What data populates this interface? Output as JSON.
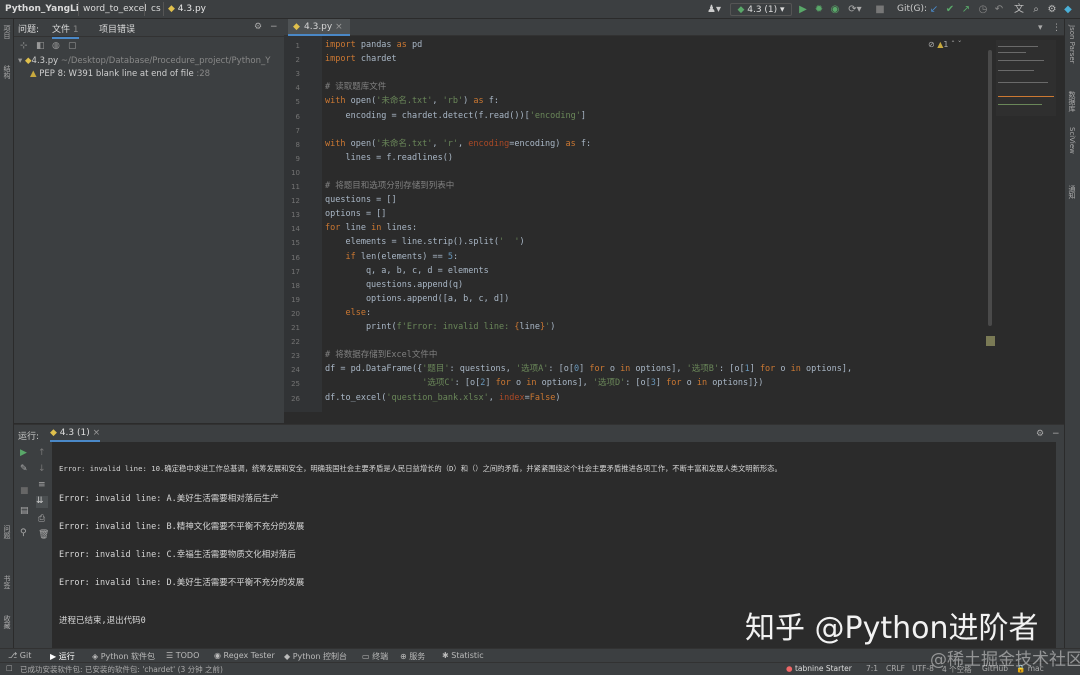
{
  "breadcrumbs": {
    "project": "Python_YangLi",
    "file1": "word_to_excel",
    "file2": "cs",
    "file3": "4.3.py"
  },
  "toolbar": {
    "run_config": "4.3 (1)",
    "git_label": "Git(G):"
  },
  "problems": {
    "tab_problems": "问题:",
    "tab_file": "文件",
    "tab_file_count": "1",
    "tab_project": "项目错误",
    "file_name": "4.3.py",
    "file_path": "~/Desktop/Database/Procedure_project/Python_Y",
    "issue": "PEP 8: W391 blank line at end of file",
    "issue_pos": ":28"
  },
  "left_strip": {
    "project": "项目",
    "structure": "结构",
    "bookmarks": "书签",
    "favorites": "收藏",
    "problems": "问题"
  },
  "right_strip": {
    "json": "Json Parser",
    "db": "数据库",
    "sciview": "SciView",
    "notify": "通知"
  },
  "editor": {
    "tab": "4.3.py",
    "inspection_count": "1"
  },
  "code_lines": [
    {
      "n": "1",
      "html": "<span class=\"k\">import</span> pandas <span class=\"k\">as</span> pd"
    },
    {
      "n": "2",
      "html": "<span class=\"k\">import</span> chardet"
    },
    {
      "n": "3",
      "html": ""
    },
    {
      "n": "4",
      "html": "<span class=\"c\"># 读取题库文件</span>"
    },
    {
      "n": "5",
      "html": "<span class=\"k\">with</span> open(<span class=\"s\">'未命名.txt'</span>, <span class=\"s\">'rb'</span>) <span class=\"k\">as</span> f:"
    },
    {
      "n": "6",
      "html": "    encoding = chardet.detect(f.read())[<span class=\"s\">'encoding'</span>]"
    },
    {
      "n": "7",
      "html": ""
    },
    {
      "n": "8",
      "html": "<span class=\"k\">with</span> open(<span class=\"s\">'未命名.txt'</span>, <span class=\"s\">'r'</span>, <span class=\"p\">encoding</span>=encoding) <span class=\"k\">as</span> f:"
    },
    {
      "n": "9",
      "html": "    lines = f.readlines()"
    },
    {
      "n": "10",
      "html": ""
    },
    {
      "n": "11",
      "html": "<span class=\"c\"># 将题目和选项分别存储到列表中</span>"
    },
    {
      "n": "12",
      "html": "questions = []"
    },
    {
      "n": "13",
      "html": "options = []"
    },
    {
      "n": "14",
      "html": "<span class=\"k\">for</span> line <span class=\"k\">in</span> lines:"
    },
    {
      "n": "15",
      "html": "    elements = line.strip().split(<span class=\"s\">'  '</span>)"
    },
    {
      "n": "16",
      "html": "    <span class=\"k\">if</span> len(elements) == <span class=\"n\">5</span>:"
    },
    {
      "n": "17",
      "html": "        q, a, b, c, d = elements"
    },
    {
      "n": "18",
      "html": "        questions.append(q)"
    },
    {
      "n": "19",
      "html": "        options.append([a, b, c, d])"
    },
    {
      "n": "20",
      "html": "    <span class=\"k\">else</span>:"
    },
    {
      "n": "21",
      "html": "        print(<span class=\"s\">f'Error: invalid line: </span><span class=\"k\">{</span>line<span class=\"k\">}</span><span class=\"s\">'</span>)"
    },
    {
      "n": "22",
      "html": ""
    },
    {
      "n": "23",
      "html": "<span class=\"c\"># 将数据存储到Excel文件中</span>"
    },
    {
      "n": "24",
      "html": "df = pd.DataFrame({<span class=\"s\">'题目'</span>: questions, <span class=\"s\">'选项A'</span>: [o[<span class=\"n\">0</span>] <span class=\"k\">for</span> o <span class=\"k\">in</span> options], <span class=\"s\">'选项B'</span>: [o[<span class=\"n\">1</span>] <span class=\"k\">for</span> o <span class=\"k\">in</span> options],"
    },
    {
      "n": "25",
      "html": "                   <span class=\"s\">'选项C'</span>: [o[<span class=\"n\">2</span>] <span class=\"k\">for</span> o <span class=\"k\">in</span> options], <span class=\"s\">'选项D'</span>: [o[<span class=\"n\">3</span>] <span class=\"k\">for</span> o <span class=\"k\">in</span> options]})"
    },
    {
      "n": "26",
      "html": "df.to_excel(<span class=\"s\">'question_bank.xlsx'</span>, <span class=\"p\">index</span>=<span class=\"k\">False</span>)"
    }
  ],
  "run": {
    "label": "运行:",
    "config": "4.3 (1)"
  },
  "console_lines": [
    "Error: invalid line: 10.确定稳中求进工作总基调，统筹发展和安全，明确我国社会主要矛盾是人民日益增长的（D）和（）之间的矛盾，并紧紧围绕这个社会主要矛盾推进各项工作，不断丰富和发展人类文明新形态。",
    "Error: invalid line: A.美好生活需要相对落后生产",
    "Error: invalid line: B.精神文化需要不平衡不充分的发展",
    "Error: invalid line: C.幸福生活需要物质文化相对落后",
    "Error: invalid line: D.美好生活需要不平衡不充分的发展",
    "进程已结束,退出代码0"
  ],
  "tool_windows": [
    "Git",
    "运行",
    "Python 软件包",
    "TODO",
    "Regex Tester",
    "Python 控制台",
    "终端",
    "服务",
    "Statistic"
  ],
  "status": {
    "message": "已成功安装软件包: 已安装的软件包: 'chardet' (3 分钟 之前)",
    "tabnine": "tabnine Starter",
    "pos": "7:1",
    "crlf": "CRLF",
    "enc": "UTF-8",
    "indent": "4 个空格",
    "vcs": "GitHub",
    "interp": "mac"
  },
  "watermark": {
    "main": "知乎 @Python进阶者",
    "site": "@稀土掘金技术社区"
  },
  "colors": {
    "keyword": "#cc7832",
    "string": "#6a8759",
    "comment": "#808080",
    "param": "#aa4926",
    "number": "#6897bb",
    "run_green": "#59a869",
    "accent": "#4a88c7"
  }
}
